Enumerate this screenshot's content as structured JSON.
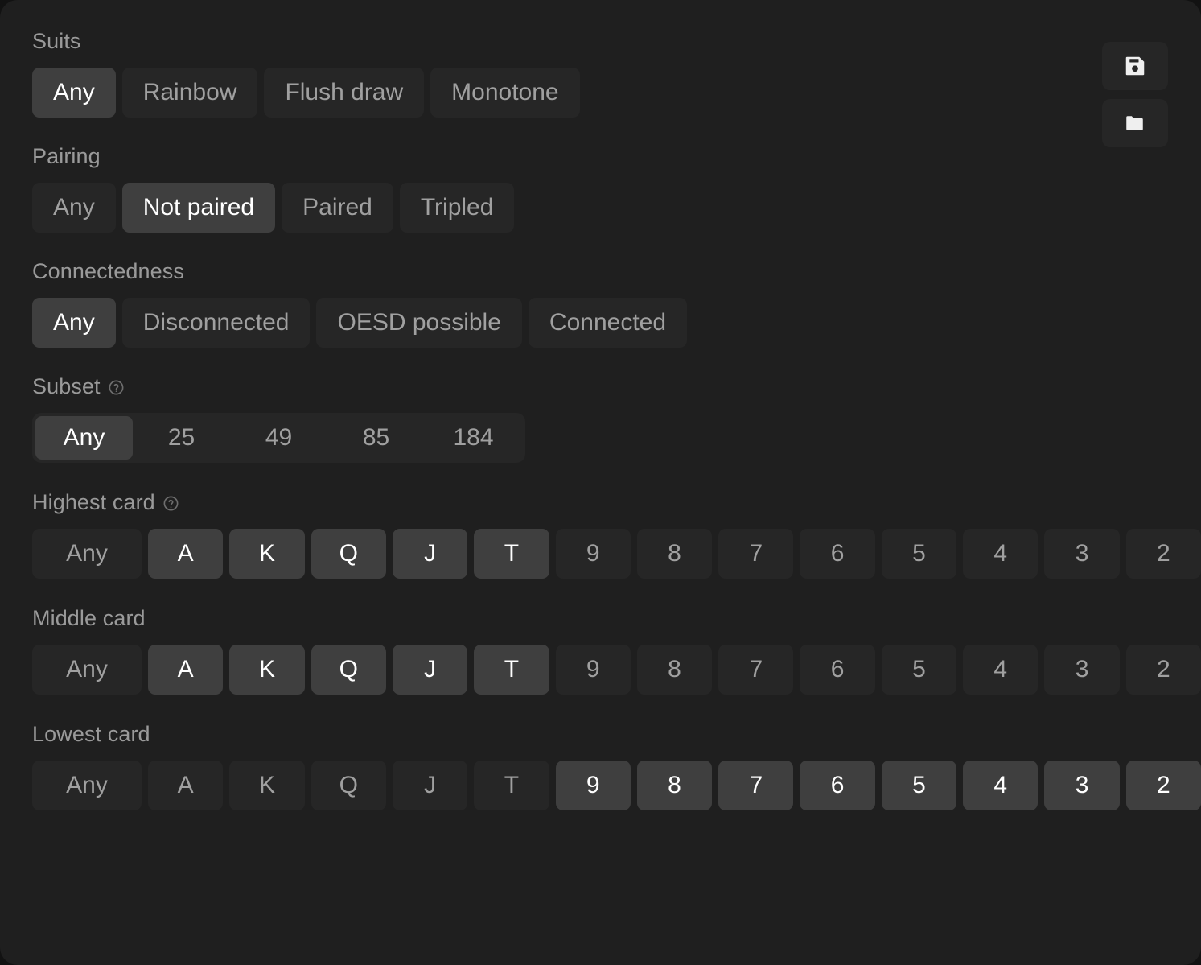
{
  "panel": {
    "accent_selected_bg": "#3f3f3f",
    "idle_bg": "#262626",
    "panel_bg": "#1f1f1f",
    "page_bg": "#121212"
  },
  "actions": {
    "save": {
      "label": "Save",
      "icon": "save-floppy-icon"
    },
    "open": {
      "label": "Open",
      "icon": "folder-icon"
    }
  },
  "groups": {
    "suits": {
      "label": "Suits",
      "has_help": false,
      "options": [
        {
          "label": "Any",
          "selected": true
        },
        {
          "label": "Rainbow",
          "selected": false
        },
        {
          "label": "Flush draw",
          "selected": false
        },
        {
          "label": "Monotone",
          "selected": false
        }
      ]
    },
    "pairing": {
      "label": "Pairing",
      "has_help": false,
      "options": [
        {
          "label": "Any",
          "selected": false
        },
        {
          "label": "Not paired",
          "selected": true
        },
        {
          "label": "Paired",
          "selected": false
        },
        {
          "label": "Tripled",
          "selected": false
        }
      ]
    },
    "connectedness": {
      "label": "Connectedness",
      "has_help": false,
      "options": [
        {
          "label": "Any",
          "selected": true
        },
        {
          "label": "Disconnected",
          "selected": false
        },
        {
          "label": "OESD possible",
          "selected": false
        },
        {
          "label": "Connected",
          "selected": false
        }
      ]
    },
    "subset": {
      "label": "Subset",
      "has_help": true,
      "options": [
        {
          "label": "Any",
          "selected": true
        },
        {
          "label": "25",
          "selected": false
        },
        {
          "label": "49",
          "selected": false
        },
        {
          "label": "85",
          "selected": false
        },
        {
          "label": "184",
          "selected": false
        }
      ]
    },
    "highest_card": {
      "label": "Highest card",
      "has_help": true,
      "options": [
        {
          "label": "Any",
          "selected": false
        },
        {
          "label": "A",
          "selected": true
        },
        {
          "label": "K",
          "selected": true
        },
        {
          "label": "Q",
          "selected": true
        },
        {
          "label": "J",
          "selected": true
        },
        {
          "label": "T",
          "selected": true
        },
        {
          "label": "9",
          "selected": false
        },
        {
          "label": "8",
          "selected": false
        },
        {
          "label": "7",
          "selected": false
        },
        {
          "label": "6",
          "selected": false
        },
        {
          "label": "5",
          "selected": false
        },
        {
          "label": "4",
          "selected": false
        },
        {
          "label": "3",
          "selected": false
        },
        {
          "label": "2",
          "selected": false
        }
      ]
    },
    "middle_card": {
      "label": "Middle card",
      "has_help": false,
      "options": [
        {
          "label": "Any",
          "selected": false
        },
        {
          "label": "A",
          "selected": true
        },
        {
          "label": "K",
          "selected": true
        },
        {
          "label": "Q",
          "selected": true
        },
        {
          "label": "J",
          "selected": true
        },
        {
          "label": "T",
          "selected": true
        },
        {
          "label": "9",
          "selected": false
        },
        {
          "label": "8",
          "selected": false
        },
        {
          "label": "7",
          "selected": false
        },
        {
          "label": "6",
          "selected": false
        },
        {
          "label": "5",
          "selected": false
        },
        {
          "label": "4",
          "selected": false
        },
        {
          "label": "3",
          "selected": false
        },
        {
          "label": "2",
          "selected": false
        }
      ]
    },
    "lowest_card": {
      "label": "Lowest card",
      "has_help": false,
      "options": [
        {
          "label": "Any",
          "selected": false
        },
        {
          "label": "A",
          "selected": false
        },
        {
          "label": "K",
          "selected": false
        },
        {
          "label": "Q",
          "selected": false
        },
        {
          "label": "J",
          "selected": false
        },
        {
          "label": "T",
          "selected": false
        },
        {
          "label": "9",
          "selected": true
        },
        {
          "label": "8",
          "selected": true
        },
        {
          "label": "7",
          "selected": true
        },
        {
          "label": "6",
          "selected": true
        },
        {
          "label": "5",
          "selected": true
        },
        {
          "label": "4",
          "selected": true
        },
        {
          "label": "3",
          "selected": true
        },
        {
          "label": "2",
          "selected": true
        }
      ]
    }
  }
}
